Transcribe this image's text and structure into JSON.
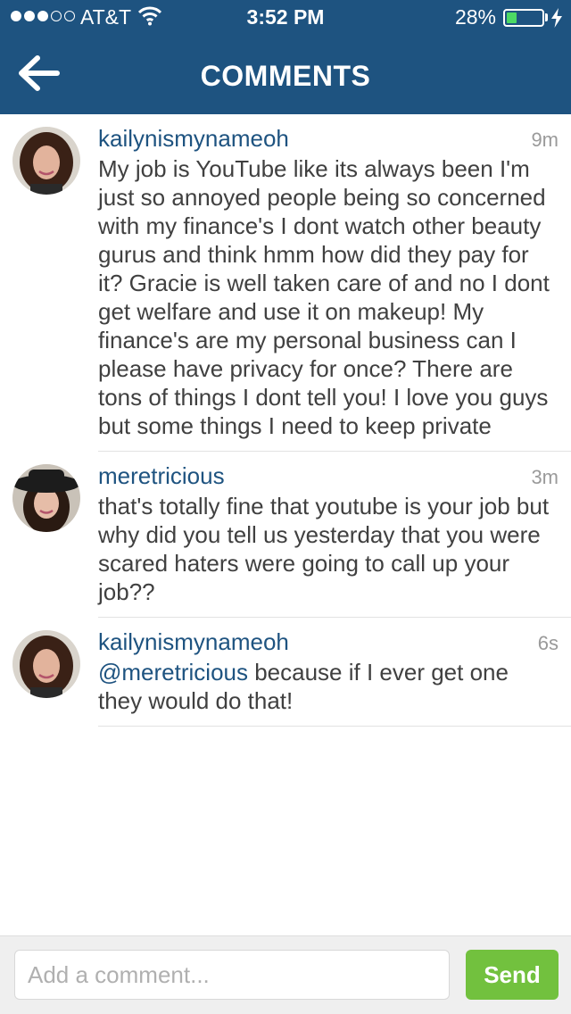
{
  "status_bar": {
    "signal": "signal-dots-3-of-5",
    "carrier": "AT&T",
    "time": "3:52 PM",
    "battery_percent": "28%",
    "battery_level": 0.28,
    "battery_color": "#4cd964"
  },
  "header": {
    "back_icon": "back-arrow-icon",
    "title": "COMMENTS",
    "background_color": "#1e5380"
  },
  "comments": [
    {
      "username": "kailynismynameoh",
      "time": "9m",
      "text": "My job is YouTube like its always been I'm just so annoyed people being so concerned with my finance's I dont watch other beauty gurus and think hmm how did they pay for it? Gracie is well taken care of and no I dont get welfare and use it on makeup! My finance's are my personal business can I please have privacy for once? There are tons of things I dont tell you! I love you guys but some things I need to keep private"
    },
    {
      "username": "meretricious",
      "time": "3m",
      "text": "that's totally fine that youtube is your job but why did you tell us yesterday that you were scared haters were going to call up your job??"
    },
    {
      "username": "kailynismynameoh",
      "time": "6s",
      "mention": "@meretricious",
      "text": " because if I ever get one they would do that!"
    }
  ],
  "composer": {
    "placeholder": "Add a comment...",
    "value": "",
    "send_label": "Send",
    "send_color": "#72c13e"
  }
}
